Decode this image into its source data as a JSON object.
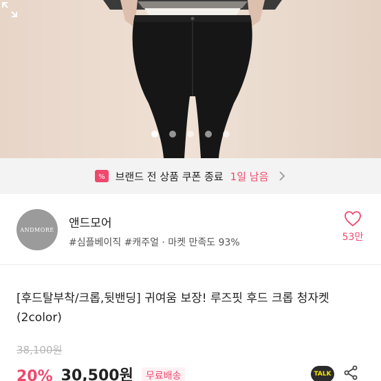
{
  "product_image": {
    "slide_count": 5,
    "active_slide": 1,
    "icons": {
      "expand": "expand-icon"
    }
  },
  "coupon_banner": {
    "text": "브랜드 전 상품 쿠폰 종료",
    "remaining": "1일 남음",
    "icons": {
      "coupon": "coupon-icon",
      "arrow": "chevron-right-icon"
    }
  },
  "shop": {
    "logo_text": "ANDMORE",
    "name": "앤드모어",
    "meta": "#심플베이직 #캐주얼 · 마켓 만족도 93%",
    "favorite_count": "53만",
    "icons": {
      "favorite": "heart-icon"
    }
  },
  "product": {
    "title": "[후드탈부착/크롭,뒷밴딩] 귀여움 보장! 루즈핏 후드 크롭 청자켓 (2color)",
    "original_price": "38,100원",
    "discount": "20%",
    "price": "30,500원",
    "shipping": "무료배송",
    "talk_label": "TALK",
    "icons": {
      "share": "share-icon",
      "talk": "kakaotalk-icon"
    }
  },
  "colors": {
    "accent": "#f0486d",
    "banner_bg": "#f3f3f3",
    "muted": "#b5b5b5"
  }
}
